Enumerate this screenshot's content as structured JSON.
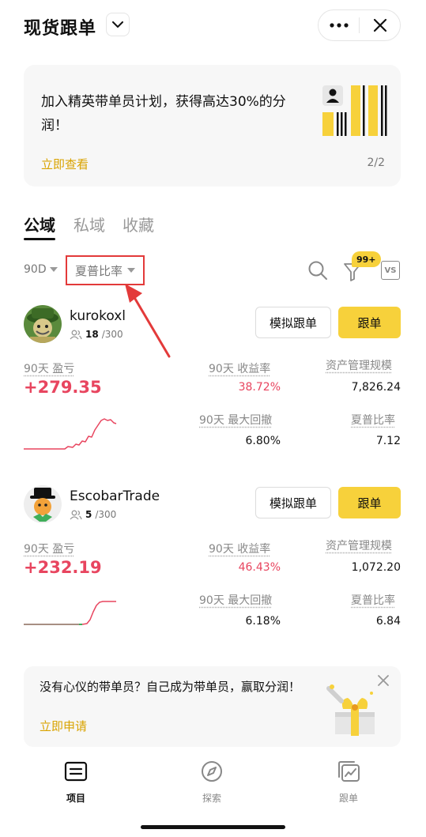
{
  "header": {
    "title": "现货跟单"
  },
  "banner": {
    "text": "加入精英带单员计划，获得高达30%的分润！",
    "link": "立即查看",
    "page": "2/2"
  },
  "tabs": [
    {
      "label": "公域",
      "active": true
    },
    {
      "label": "私域",
      "active": false
    },
    {
      "label": "收藏",
      "active": false
    }
  ],
  "filters": {
    "period": "90D",
    "sort": "夏普比率",
    "badge": "99+",
    "vs_label": "VS"
  },
  "labels": {
    "pnl": "90天 盈亏",
    "roi": "90天 收益率",
    "aum": "资产管理规模",
    "mdd": "90天 最大回撤",
    "sharpe": "夏普比率",
    "simulate": "模拟跟单",
    "follow": "跟单"
  },
  "traders": [
    {
      "name": "kurokoxl",
      "followers": "18",
      "max_followers": "/300",
      "pnl": "+279.35",
      "roi": "38.72%",
      "aum": "7,826.24",
      "mdd": "6.80%",
      "sharpe": "7.12"
    },
    {
      "name": "EscobarTrade",
      "followers": "5",
      "max_followers": "/300",
      "pnl": "+232.19",
      "roi": "46.43%",
      "aum": "1,072.20",
      "mdd": "6.18%",
      "sharpe": "6.84"
    }
  ],
  "promo": {
    "text": "没有心仪的带单员？自己成为带单员，赢取分润！",
    "link": "立即申请"
  },
  "nav": [
    {
      "label": "项目",
      "active": true
    },
    {
      "label": "探索",
      "active": false
    },
    {
      "label": "跟单",
      "active": false
    }
  ],
  "colors": {
    "accent_yellow": "#f7d13b",
    "link_gold": "#d9a300",
    "profit_red": "#e8455f",
    "highlight_box": "#e33a3a"
  }
}
